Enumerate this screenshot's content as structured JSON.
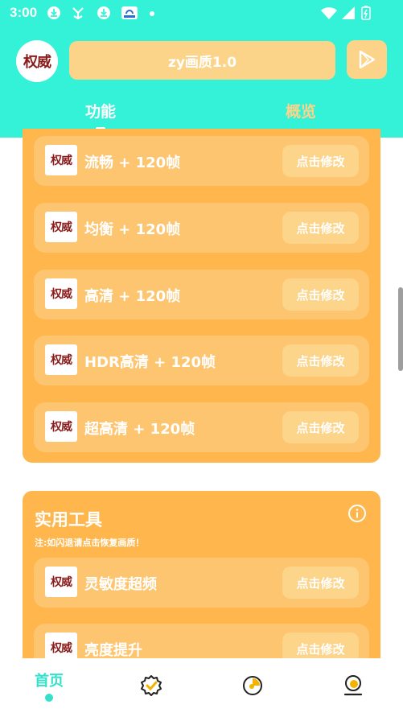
{
  "status_bar": {
    "time": "3:00",
    "icons": [
      "download-icon",
      "fork-icon",
      "download-icon",
      "app-badge-icon",
      "wifi-icon",
      "signal-icon",
      "battery-icon"
    ]
  },
  "header": {
    "logo_text": "权威",
    "title": "zy画质1.0",
    "tabs": [
      {
        "label": "功能",
        "active": true
      },
      {
        "label": "概览",
        "active": false
      }
    ]
  },
  "quality_items": [
    {
      "icon_text": "权威",
      "label": "流畅 + 120帧",
      "button": "点击修改"
    },
    {
      "icon_text": "权威",
      "label": "均衡 + 120帧",
      "button": "点击修改"
    },
    {
      "icon_text": "权威",
      "label": "高清 + 120帧",
      "button": "点击修改"
    },
    {
      "icon_text": "权威",
      "label": "HDR高清 + 120帧",
      "button": "点击修改"
    },
    {
      "icon_text": "权威",
      "label": "超高清 + 120帧",
      "button": "点击修改"
    }
  ],
  "tools": {
    "title": "实用工具",
    "note": "注:如闪退请点击恢复画质！",
    "items": [
      {
        "icon_text": "权威",
        "label": "灵敏度超频",
        "button": "点击修改"
      },
      {
        "icon_text": "权威",
        "label": "亮度提升",
        "button": "点击修改"
      }
    ]
  },
  "bottom_nav": {
    "items": [
      {
        "label": "首页",
        "icon": "home",
        "active": true
      },
      {
        "label": "",
        "icon": "badge-check-icon",
        "active": false
      },
      {
        "label": "",
        "icon": "pie-chart-icon",
        "active": false
      },
      {
        "label": "",
        "icon": "profile-icon",
        "active": false
      }
    ]
  },
  "colors": {
    "header_bg": "#34f2d7",
    "panel_bg": "#ffb74d",
    "item_bg": "#fdc56f",
    "button_bg": "#fcd48a",
    "accent": "#34e0c9"
  }
}
